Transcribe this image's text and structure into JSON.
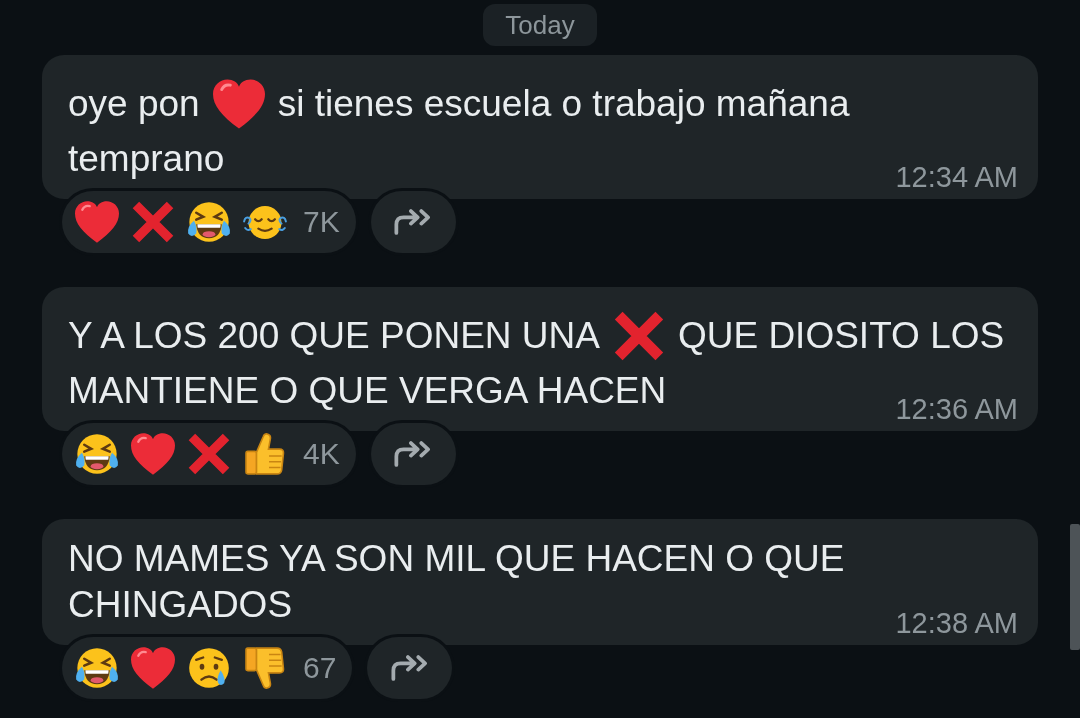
{
  "date_chip": {
    "label": "Today"
  },
  "messages": [
    {
      "lines": [
        [
          {
            "kind": "text",
            "text": "oye pon"
          },
          {
            "kind": "heart"
          },
          {
            "kind": "text",
            "text": "si tienes escuela o trabajo mañana"
          }
        ],
        [
          {
            "kind": "text",
            "text": "temprano"
          }
        ]
      ],
      "time": "12:34 AM",
      "reactions": {
        "emojis": [
          {
            "kind": "heart"
          },
          {
            "kind": "cross"
          },
          {
            "kind": "laugh"
          },
          {
            "kind": "relieved"
          }
        ],
        "count": "7K"
      }
    },
    {
      "lines": [
        [
          {
            "kind": "text",
            "text": "Y A LOS 200 QUE PONEN UNA"
          },
          {
            "kind": "cross"
          },
          {
            "kind": "text",
            "text": "QUE DIOSITO LOS"
          }
        ],
        [
          {
            "kind": "text",
            "text": "MANTIENE O QUE VERGA HACEN"
          }
        ]
      ],
      "time": "12:36 AM",
      "reactions": {
        "emojis": [
          {
            "kind": "laugh"
          },
          {
            "kind": "heart"
          },
          {
            "kind": "cross"
          },
          {
            "kind": "thumbs_up"
          }
        ],
        "count": "4K"
      }
    },
    {
      "lines": [
        [
          {
            "kind": "text",
            "text": "NO MAMES YA SON MIL QUE HACEN O QUE CHINGADOS"
          }
        ]
      ],
      "time": "12:38 AM",
      "reactions": {
        "emojis": [
          {
            "kind": "laugh"
          },
          {
            "kind": "heart"
          },
          {
            "kind": "sad"
          },
          {
            "kind": "thumbs_down"
          }
        ],
        "count": "67"
      }
    }
  ]
}
